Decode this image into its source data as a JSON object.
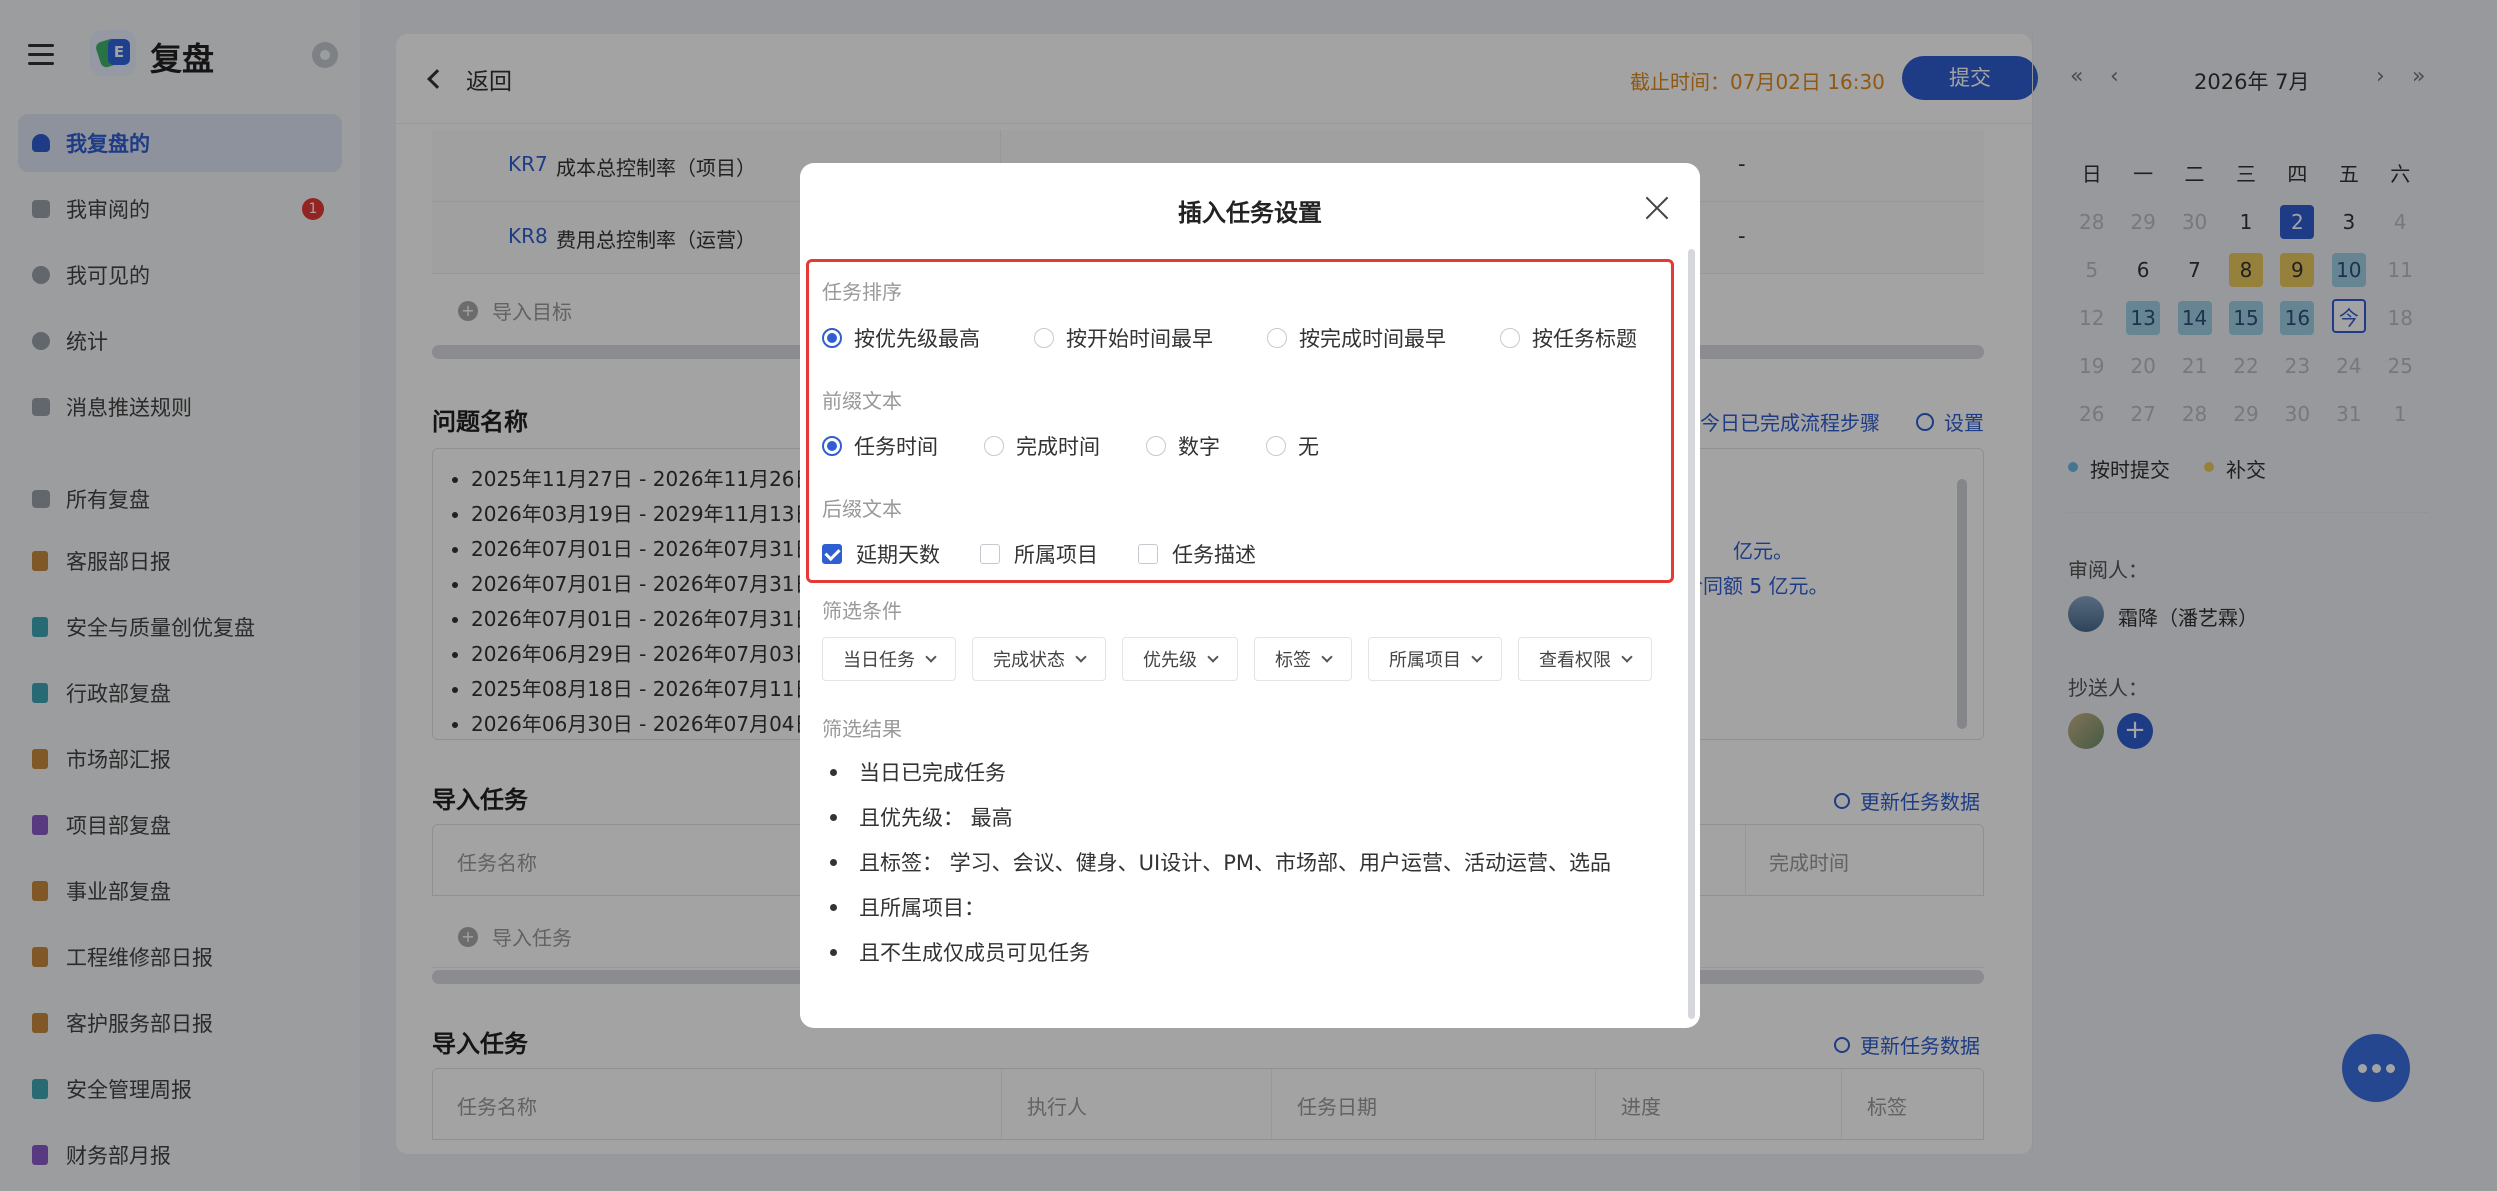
{
  "sidebar": {
    "app_title": "复盘",
    "items": [
      {
        "label": "我复盘的"
      },
      {
        "label": "我审阅的",
        "badge": "1"
      },
      {
        "label": "我可见的"
      },
      {
        "label": "统计"
      },
      {
        "label": "消息推送规则"
      }
    ],
    "all_label": "所有复盘",
    "reviews": [
      {
        "label": "客服部日报",
        "color": "#c98a3e"
      },
      {
        "label": "安全与质量创优复盘",
        "color": "#3fa7b5"
      },
      {
        "label": "行政部复盘",
        "color": "#3fa7b5"
      },
      {
        "label": "市场部汇报",
        "color": "#c98a3e"
      },
      {
        "label": "项目部复盘",
        "color": "#8a5bc9"
      },
      {
        "label": "事业部复盘",
        "color": "#c98a3e"
      },
      {
        "label": "工程维修部日报",
        "color": "#c98a3e"
      },
      {
        "label": "客护服务部日报",
        "color": "#c98a3e"
      },
      {
        "label": "安全管理周报",
        "color": "#3fa7b5"
      },
      {
        "label": "财务部月报",
        "color": "#8a5bc9"
      }
    ]
  },
  "main": {
    "back_label": "返回",
    "deadline": "截止时间：07月02日 16:30",
    "submit_label": "提交",
    "kr_rows": [
      {
        "code": "KR7",
        "title": "成本总控制率（项目）",
        "value": "-"
      },
      {
        "code": "KR8",
        "title": "费用总控制率（运营）",
        "value": "-"
      }
    ],
    "import_goal": "导入目标",
    "problem_title": "问题名称",
    "problem_link": "今日已完成流程步骤",
    "settings_label": "设置",
    "problem_items": [
      "2025年11月27日 - 2026年11月26日",
      "2026年03月19日 - 2029年11月13日",
      "2026年07月01日 - 2026年07月31日",
      "2026年07月01日 - 2026年07月31日",
      "2026年07月01日 - 2026年07月31日",
      "2026年06月29日 - 2026年07月03日",
      "2025年08月18日 - 2026年07月11日",
      "2026年06月30日 - 2026年07月04日"
    ],
    "problem_right_1": "亿元。",
    "problem_right_2": "合同额 5 亿元。",
    "import_task_title": "导入任务",
    "refresh_label": "更新任务数据",
    "table1_headers": [
      "任务名称",
      "完成时间"
    ],
    "import_task_link": "导入任务",
    "table2_headers": [
      "任务名称",
      "执行人",
      "任务日期",
      "进度",
      "标签"
    ]
  },
  "calendar": {
    "title": "2026年 7月",
    "weekdays": [
      "日",
      "一",
      "二",
      "三",
      "四",
      "五",
      "六"
    ],
    "weeks": [
      [
        "28",
        "29",
        "30",
        "1",
        "2",
        "3",
        "4"
      ],
      [
        "5",
        "6",
        "7",
        "8",
        "9",
        "10",
        "11"
      ],
      [
        "12",
        "13",
        "14",
        "15",
        "16",
        "今",
        "18"
      ],
      [
        "19",
        "20",
        "21",
        "22",
        "23",
        "24",
        "25"
      ],
      [
        "26",
        "27",
        "28",
        "29",
        "30",
        "31",
        "1"
      ]
    ],
    "legend_on_time": "按时提交",
    "legend_late": "补交",
    "on_time_color": "#6fb7e3",
    "late_color": "#e9c85e",
    "reviewer_label": "审阅人：",
    "reviewer_name": "霜降（潘艺霖）",
    "cc_label": "抄送人："
  },
  "modal": {
    "title": "插入任务设置",
    "sort_label": "任务排序",
    "sort_options": [
      "按优先级最高",
      "按开始时间最早",
      "按完成时间最早",
      "按任务标题"
    ],
    "sort_selected": 0,
    "prefix_label": "前缀文本",
    "prefix_options": [
      "任务时间",
      "完成时间",
      "数字",
      "无"
    ],
    "prefix_selected": 0,
    "suffix_label": "后缀文本",
    "suffix_options": [
      {
        "label": "延期天数",
        "checked": true
      },
      {
        "label": "所属项目",
        "checked": false
      },
      {
        "label": "任务描述",
        "checked": false
      }
    ],
    "filter_label": "筛选条件",
    "filters": [
      "当日任务",
      "完成状态",
      "优先级",
      "标签",
      "所属项目",
      "查看权限"
    ],
    "result_label": "筛选结果",
    "results": [
      "当日已完成任务",
      "且优先级：  最高",
      "且标签：  学习、会议、健身、UI设计、PM、市场部、用户运营、活动运营、选品",
      "且所属项目：",
      "且不生成仅成员可见任务"
    ]
  }
}
